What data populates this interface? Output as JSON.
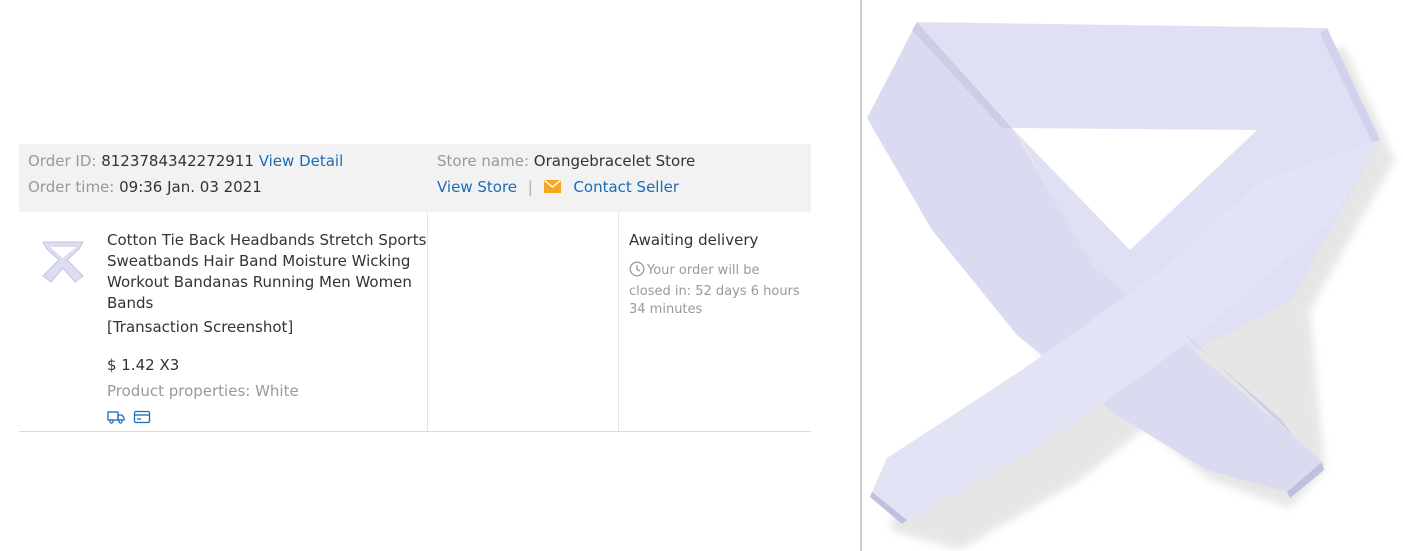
{
  "order": {
    "id_label": "Order ID:",
    "id_value": "8123784342272911",
    "view_detail": "View Detail",
    "time_label": "Order time:",
    "time_value": "09:36 Jan. 03 2021",
    "store_label": "Store name:",
    "store_value": "Orangebracelet Store",
    "view_store": "View Store",
    "separator": "|",
    "contact_seller": "Contact Seller"
  },
  "product": {
    "title": "Cotton Tie Back Headbands Stretch Sports Sweatbands Hair Band Moisture Wicking Workout Bandanas Running Men Women Bands",
    "note": "[Transaction Screenshot]",
    "price": "$ 1.42 X3",
    "properties": "Product properties: White",
    "icons": [
      "delivery-truck-icon",
      "payment-card-icon"
    ]
  },
  "status": {
    "title": "Awaiting delivery",
    "note": "Your order will be closed in: 52 days 6 hours 34 minutes",
    "icon": "clock-icon"
  },
  "colors": {
    "link": "#1a6cb8",
    "header_bg": "#f2f2f2",
    "muted": "#999999",
    "mail_icon": "#f5a623",
    "product_lavender": "#dcdcf2"
  }
}
